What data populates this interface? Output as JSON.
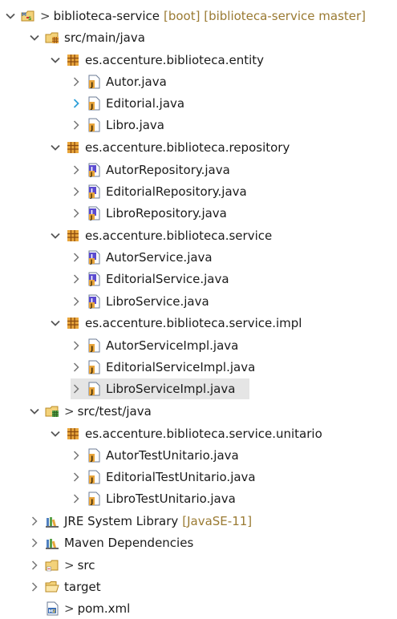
{
  "tree": {
    "project": {
      "prefix": ">",
      "name": "biblioteca-service",
      "decoration": "[boot] [biblioteca-service master]"
    },
    "main_folder": {
      "name": "src/main/java"
    },
    "pkg_entity": {
      "name": "es.accenture.biblioteca.entity"
    },
    "entity_files": [
      "Autor.java",
      "Editorial.java",
      "Libro.java"
    ],
    "pkg_repository": {
      "name": "es.accenture.biblioteca.repository"
    },
    "repository_files": [
      "AutorRepository.java",
      "EditorialRepository.java",
      "LibroRepository.java"
    ],
    "pkg_service": {
      "name": "es.accenture.biblioteca.service"
    },
    "service_files": [
      "AutorService.java",
      "EditorialService.java",
      "LibroService.java"
    ],
    "pkg_impl": {
      "name": "es.accenture.biblioteca.service.impl"
    },
    "impl_files": [
      "AutorServiceImpl.java",
      "EditorialServiceImpl.java",
      "LibroServiceImpl.java"
    ],
    "test_folder": {
      "prefix": ">",
      "name": "src/test/java"
    },
    "pkg_test": {
      "name": "es.accenture.biblioteca.service.unitario"
    },
    "test_files": [
      "AutorTestUnitario.java",
      "EditorialTestUnitario.java",
      "LibroTestUnitario.java"
    ],
    "jre": {
      "name": "JRE System Library",
      "decoration": "[JavaSE-11]"
    },
    "maven": {
      "name": "Maven Dependencies"
    },
    "src": {
      "prefix": ">",
      "name": "src"
    },
    "target": {
      "name": "target"
    },
    "pom": {
      "prefix": ">",
      "name": "pom.xml"
    }
  },
  "selected_item": "LibroServiceImpl.java",
  "colors": {
    "selection": "#e5e5e5",
    "decoration": "#9a7a32",
    "twisty": "#555555",
    "twisty_highlight": "#2fa0d8"
  }
}
